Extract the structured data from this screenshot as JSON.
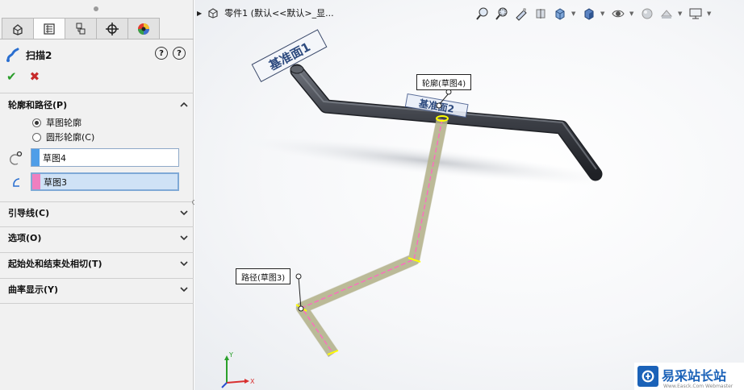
{
  "property_manager": {
    "tabs": [
      {
        "icon": "feature-manager-icon",
        "active": false
      },
      {
        "icon": "property-manager-icon",
        "active": true
      },
      {
        "icon": "configuration-manager-icon",
        "active": false
      },
      {
        "icon": "dimxpert-icon",
        "active": false
      },
      {
        "icon": "display-manager-icon",
        "active": false
      }
    ],
    "feature_title": "扫描2",
    "feature_icon": "sweep-icon",
    "groups": {
      "profile_path": {
        "title": "轮廓和路径(P)",
        "options": [
          {
            "label": "草图轮廓",
            "selected": true
          },
          {
            "label": "圆形轮廓(C)",
            "selected": false
          }
        ],
        "profile_value": "草图4",
        "profile_color": "#4f9ee8",
        "path_value": "草图3",
        "path_color": "#ef7fc0"
      },
      "guide_curves": {
        "title": "引导线(C)"
      },
      "options": {
        "title": "选项(O)"
      },
      "tangency": {
        "title": "起始处和结束处相切(T)"
      },
      "curvature": {
        "title": "曲率显示(Y)"
      }
    }
  },
  "graphics": {
    "tree_label": "零件1 (默认<<默认>_显...",
    "plane_labels": {
      "plane1": "基准面1",
      "plane2": "基准面2"
    },
    "callouts": {
      "profile": "轮廓(草图4)",
      "path": "路径(草图3)"
    },
    "axes": {
      "x": "X",
      "y": "Y"
    }
  },
  "watermark": {
    "text": "易采站长站",
    "sub": "Www.Easck.Com Webmaster",
    "color": "#1b62b8"
  },
  "colors": {
    "accept": "#2a9d2a",
    "cancel": "#c72a2a",
    "path_line": "#ff6ac1",
    "sweep_body": "#c9c8a8",
    "highlight": "#ffff00"
  }
}
